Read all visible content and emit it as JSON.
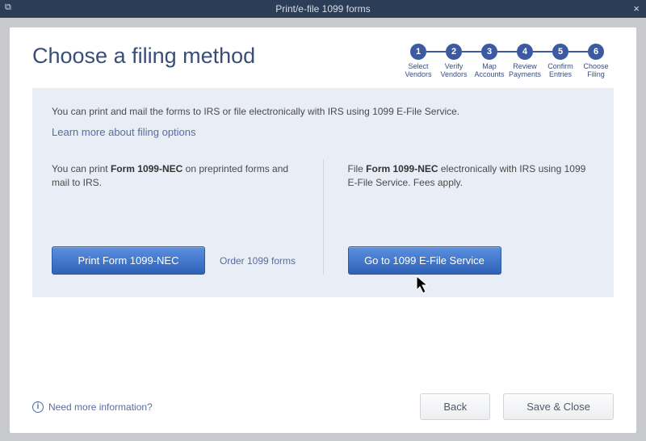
{
  "titlebar": {
    "title": "Print/e-file 1099 forms",
    "menu_glyph": "⧉",
    "close_glyph": "×"
  },
  "page": {
    "heading": "Choose a filing method"
  },
  "stepper": [
    {
      "num": "1",
      "label1": "Select",
      "label2": "Vendors"
    },
    {
      "num": "2",
      "label1": "Verify",
      "label2": "Vendors"
    },
    {
      "num": "3",
      "label1": "Map",
      "label2": "Accounts"
    },
    {
      "num": "4",
      "label1": "Review",
      "label2": "Payments"
    },
    {
      "num": "5",
      "label1": "Confirm",
      "label2": "Entries"
    },
    {
      "num": "6",
      "label1": "Choose",
      "label2": "Filing"
    }
  ],
  "panel": {
    "intro": "You can print and mail the forms to IRS or file electronically with IRS using 1099 E-File Service.",
    "learn_link": "Learn more about filing options"
  },
  "left": {
    "pre": "You can print ",
    "strong": "Form 1099-NEC",
    "post": " on preprinted forms and mail to IRS.",
    "button": "Print Form 1099-NEC",
    "order_link": "Order 1099 forms"
  },
  "right": {
    "pre": "File ",
    "strong": "Form 1099-NEC",
    "post": " electronically with IRS using 1099 E-File Service. Fees apply.",
    "button": "Go to 1099 E-File Service"
  },
  "footer": {
    "need_info": "Need more information?",
    "back": "Back",
    "save_close": "Save & Close"
  }
}
